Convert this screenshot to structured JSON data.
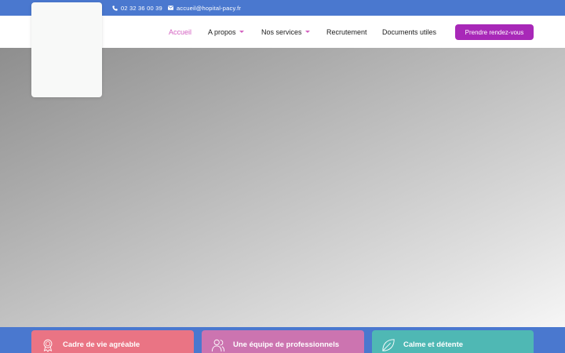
{
  "topbar": {
    "phone": "02 32 36 00 39",
    "email": "accueil@hopital-pacy.fr"
  },
  "nav": {
    "items": [
      {
        "label": "Accueil",
        "active": true,
        "dropdown": false
      },
      {
        "label": "A propos",
        "active": false,
        "dropdown": true
      },
      {
        "label": "Nos services",
        "active": false,
        "dropdown": true
      },
      {
        "label": "Recrutement",
        "active": false,
        "dropdown": false
      },
      {
        "label": "Documents utiles",
        "active": false,
        "dropdown": false
      }
    ],
    "cta_label": "Prendre rendez-vous"
  },
  "features": [
    {
      "label": "Cadre de vie agréable",
      "icon": "award-icon",
      "color": "#ea7484"
    },
    {
      "label": "Une équipe de professionnels",
      "icon": "users-icon",
      "color": "#cc74b0"
    },
    {
      "label": "Calme et détente",
      "icon": "leaf-icon",
      "color": "#4fb8b4"
    }
  ],
  "colors": {
    "brand_blue": "#4a78cf",
    "accent_purple": "#a828b8",
    "active_pink": "#d361c0"
  }
}
